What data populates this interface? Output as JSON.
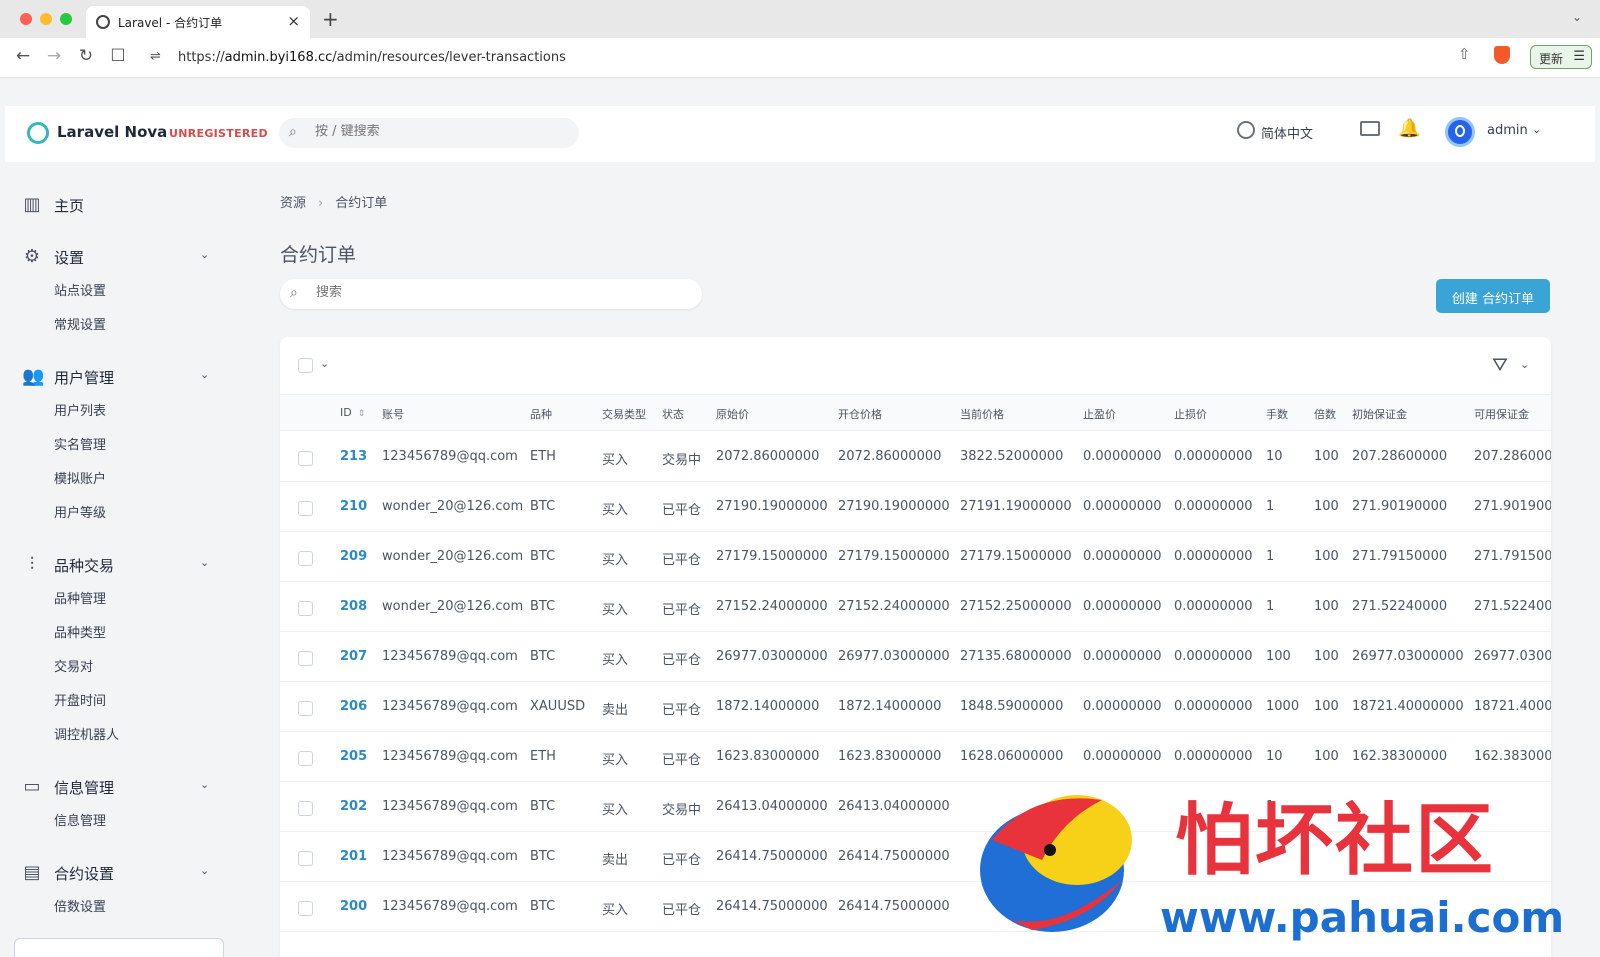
{
  "browser": {
    "tab_title": "Laravel - 合约订单",
    "tab_close": "×",
    "new_tab": "+",
    "url_prefix": "https://",
    "url_host": "admin.byi168.cc",
    "url_path": "/admin/resources/lever-transactions",
    "update_label": "更新",
    "tab_menu": "⌄"
  },
  "header": {
    "logo_text": "Laravel Nova",
    "badge": "UNREGISTERED",
    "search_placeholder": "按 / 键搜索",
    "language": "简体中文",
    "user": "admin"
  },
  "sidebar": {
    "home": "主页",
    "settings": {
      "label": "设置",
      "items": [
        "站点设置",
        "常规设置"
      ]
    },
    "users": {
      "label": "用户管理",
      "items": [
        "用户列表",
        "实名管理",
        "模拟账户",
        "用户等级"
      ]
    },
    "trading": {
      "label": "品种交易",
      "items": [
        "品种管理",
        "品种类型",
        "交易对",
        "开盘时间",
        "调控机器人"
      ]
    },
    "messages": {
      "label": "信息管理",
      "items": [
        "信息管理"
      ]
    },
    "contract": {
      "label": "合约设置",
      "items": [
        "倍数设置"
      ]
    }
  },
  "main": {
    "breadcrumb": [
      "资源",
      "合约订单"
    ],
    "title": "合约订单",
    "search_placeholder": "搜索",
    "create_button": "创建 合约订单"
  },
  "table": {
    "columns": [
      "ID",
      "账号",
      "品种",
      "交易类型",
      "状态",
      "原始价",
      "开仓价格",
      "当前价格",
      "止盈价",
      "止损价",
      "手数",
      "倍数",
      "初始保证金",
      "可用保证金"
    ],
    "rows": [
      [
        "213",
        "123456789@qq.com",
        "ETH",
        "买入",
        "交易中",
        "2072.86000000",
        "2072.86000000",
        "3822.52000000",
        "0.00000000",
        "0.00000000",
        "10",
        "100",
        "207.28600000",
        "207.286000"
      ],
      [
        "210",
        "wonder_20@126.com",
        "BTC",
        "买入",
        "已平仓",
        "27190.19000000",
        "27190.19000000",
        "27191.19000000",
        "0.00000000",
        "0.00000000",
        "1",
        "100",
        "271.90190000",
        "271.901900"
      ],
      [
        "209",
        "wonder_20@126.com",
        "BTC",
        "买入",
        "已平仓",
        "27179.15000000",
        "27179.15000000",
        "27179.15000000",
        "0.00000000",
        "0.00000000",
        "1",
        "100",
        "271.79150000",
        "271.791500"
      ],
      [
        "208",
        "wonder_20@126.com",
        "BTC",
        "买入",
        "已平仓",
        "27152.24000000",
        "27152.24000000",
        "27152.25000000",
        "0.00000000",
        "0.00000000",
        "1",
        "100",
        "271.52240000",
        "271.522400"
      ],
      [
        "207",
        "123456789@qq.com",
        "BTC",
        "买入",
        "已平仓",
        "26977.03000000",
        "26977.03000000",
        "27135.68000000",
        "0.00000000",
        "0.00000000",
        "100",
        "100",
        "26977.03000000",
        "26977.0300"
      ],
      [
        "206",
        "123456789@qq.com",
        "XAUUSD",
        "卖出",
        "已平仓",
        "1872.14000000",
        "1872.14000000",
        "1848.59000000",
        "0.00000000",
        "0.00000000",
        "1000",
        "100",
        "18721.40000000",
        "18721.4000"
      ],
      [
        "205",
        "123456789@qq.com",
        "ETH",
        "买入",
        "已平仓",
        "1623.83000000",
        "1623.83000000",
        "1628.06000000",
        "0.00000000",
        "0.00000000",
        "10",
        "100",
        "162.38300000",
        "162.383000"
      ],
      [
        "202",
        "123456789@qq.com",
        "BTC",
        "买入",
        "交易中",
        "26413.04000000",
        "26413.04000000",
        "",
        "",
        "",
        "1",
        "",
        "",
        ""
      ],
      [
        "201",
        "123456789@qq.com",
        "BTC",
        "卖出",
        "已平仓",
        "26414.75000000",
        "26414.75000000",
        "",
        "",
        "",
        "",
        "",
        "",
        ""
      ],
      [
        "200",
        "123456789@qq.com",
        "BTC",
        "买入",
        "已平仓",
        "26414.75000000",
        "26414.75000000",
        "",
        "",
        "",
        "",
        "",
        "",
        ""
      ]
    ]
  },
  "watermark": {
    "text": "怕坏社区",
    "url": "www.pahuai.com"
  },
  "colors": {
    "accent": "#3ba4d6",
    "id_link": "#2b8ac7",
    "badge_red": "#dc4a4a"
  },
  "icons": {
    "back": "←",
    "forward": "→",
    "reload": "↻",
    "bookmark": "☐",
    "site_info": "⇌",
    "share": "⇧",
    "menu": "☰",
    "search": "⌕",
    "bell": "🔔",
    "chevron": "⌄",
    "home": "▥",
    "gear": "⚙",
    "users": "👥",
    "sliders": "⫶",
    "message": "▭",
    "presentation": "▤",
    "filter": "⛛",
    "sort": "⇕"
  }
}
